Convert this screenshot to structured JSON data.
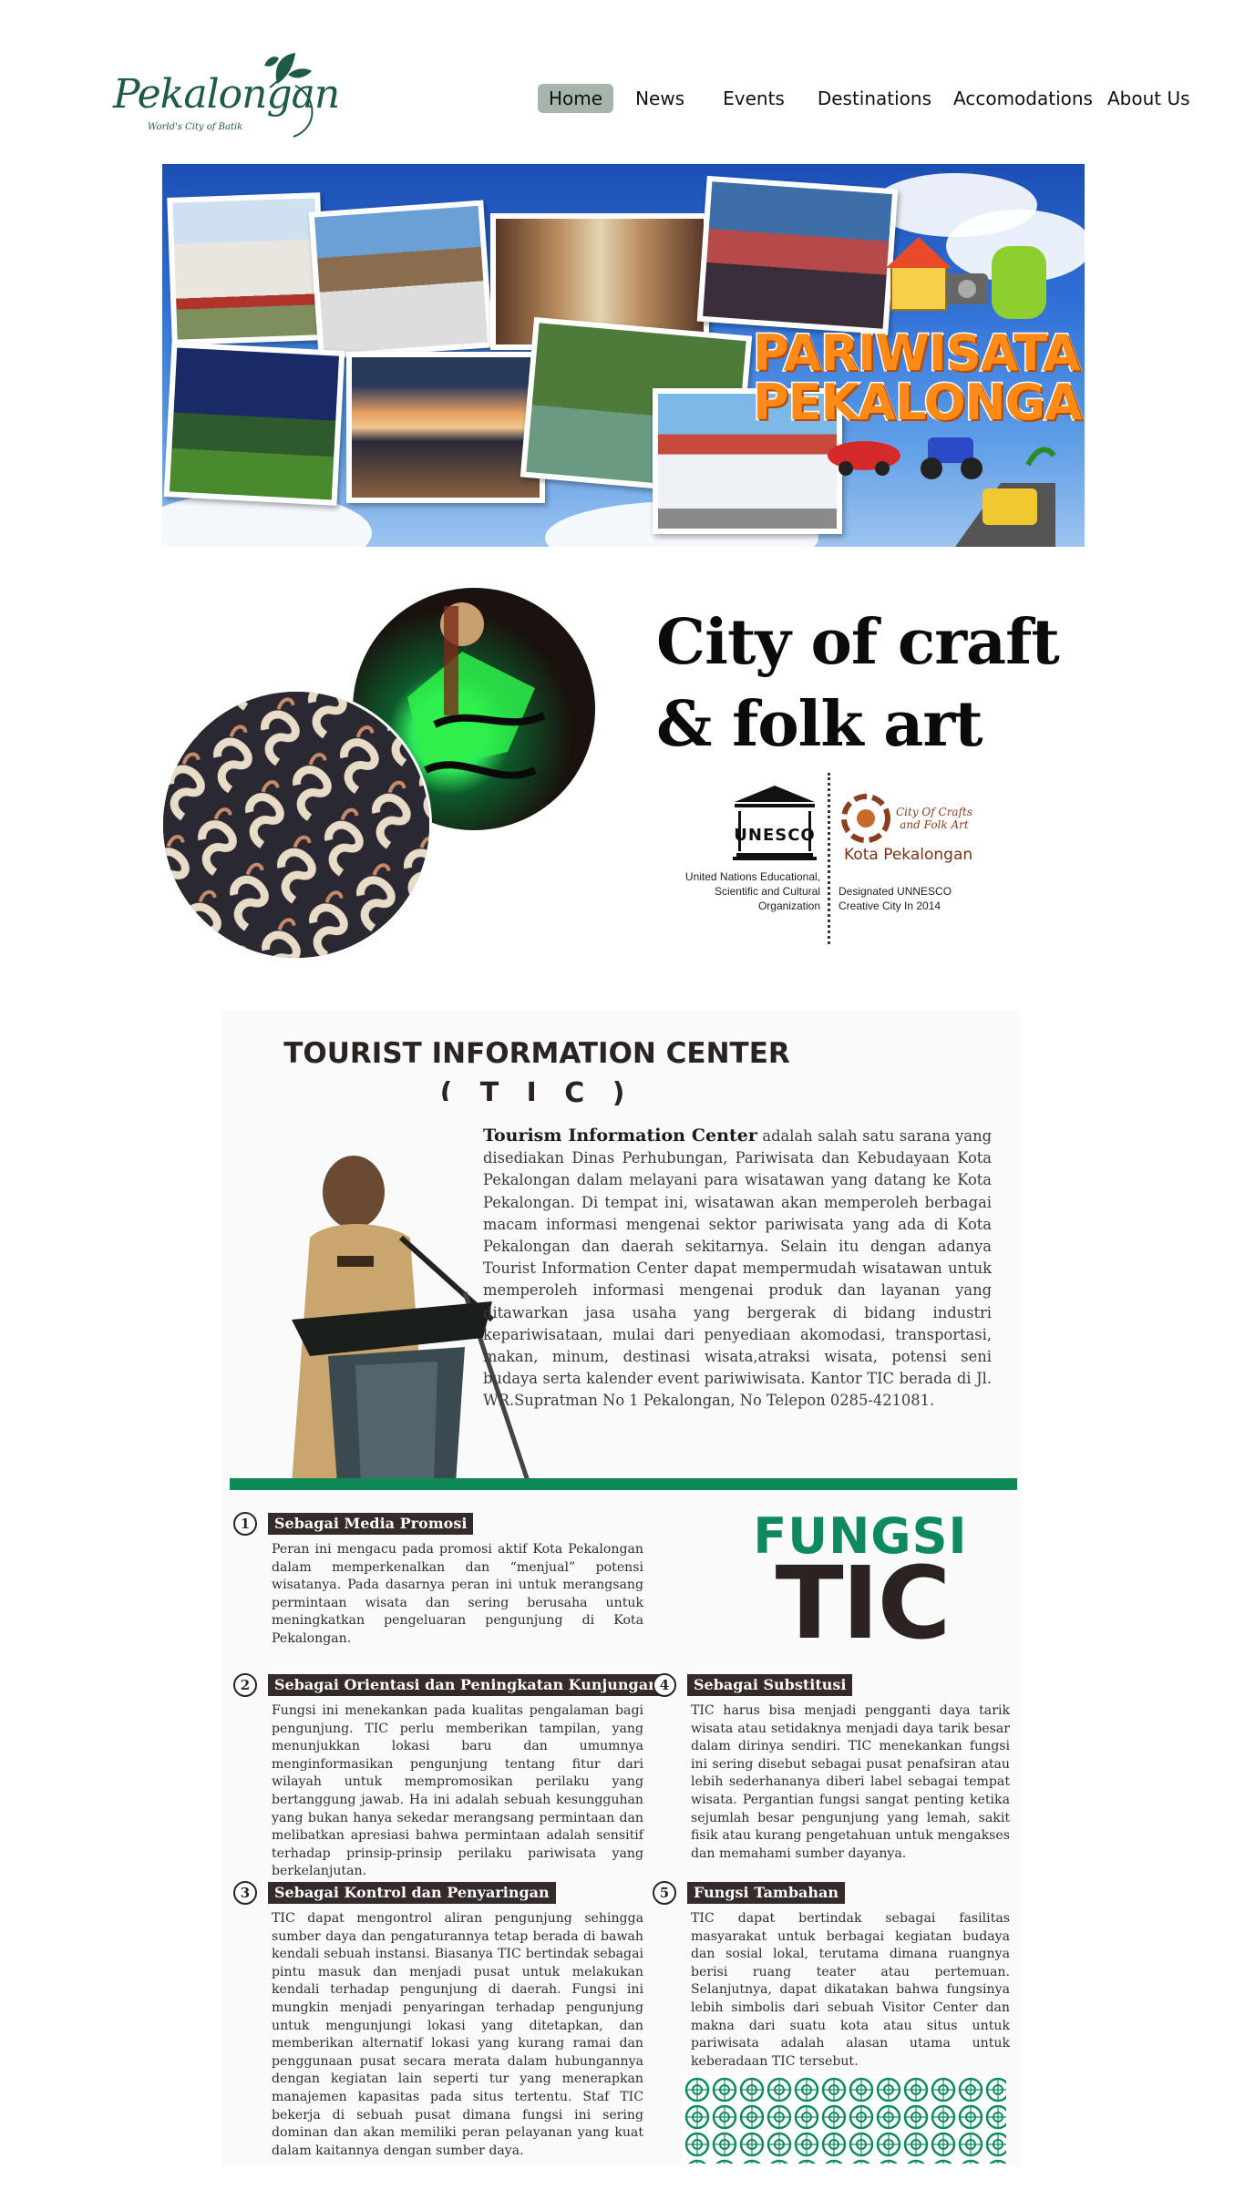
{
  "header": {
    "logo_text": "Pekalongan",
    "logo_tagline": "World's City of Batik",
    "nav": [
      "Home",
      "News",
      "Events",
      "Destinations",
      "Accomodations",
      "About Us"
    ],
    "active_nav": "Home"
  },
  "hero": {
    "title_line1": "PARIWISATA",
    "title_line2": "PEKALONGAN"
  },
  "craft": {
    "title": "City of craft & folk art",
    "unesco_name": "UNESCO",
    "unesco_label": "United Nations Educational, Scientific and Cultural Organization",
    "badge_text": "City Of Crafts and Folk Art",
    "kota": "Kota Pekalongan",
    "designated": "Designated UNNESCO Creative City In 2014"
  },
  "tic": {
    "heading": "TOURIST INFORMATION CENTER",
    "subheading": "( T I C )",
    "lead": "Tourism Information Center",
    "intro": " adalah salah satu sarana yang disediakan Dinas Perhubungan, Pariwisata dan Kebudayaan Kota Pekalongan dalam melayani para wisatawan yang datang ke Kota Pekalongan. Di tempat ini, wisatawan akan memperoleh berbagai macam informasi mengenai sektor pariwisata yang ada di Kota Pekalongan dan daerah sekitarnya. Selain itu dengan adanya Tourist Information Center dapat mempermudah wisatawan untuk memperoleh informasi mengenai produk dan layanan yang ditawarkan jasa usaha yang bergerak di bidang industri kepariwisataan, mulai dari penyediaan akomodasi, transportasi, makan, minum, destinasi wisata,atraksi wisata, potensi seni budaya serta kalender event pariwiwisata. Kantor TIC berada di Jl. WR.Supratman No 1 Pekalongan, No Telepon 0285-421081.",
    "fungsi_word": "FUNGSI",
    "fungsi_tic": "TIC",
    "functions": [
      {
        "num": "1",
        "title": "Sebagai Media Promosi",
        "body": "Peran ini mengacu pada promosi aktif Kota Pekalongan dalam memperkenalkan dan “menjual” potensi wisatanya. Pada dasarnya peran ini untuk merangsang permintaan wisata dan sering berusaha untuk meningkatkan pengeluaran pengunjung di Kota Pekalongan."
      },
      {
        "num": "2",
        "title": "Sebagai Orientasi dan Peningkatan Kunjungan",
        "body": "Fungsi ini menekankan pada kualitas pengalaman bagi pengunjung. TIC perlu memberikan tampilan, yang menunjukkan lokasi baru dan umumnya menginformasikan pengunjung tentang fitur dari wilayah untuk mempromosikan perilaku yang bertanggung jawab. Ha ini adalah sebuah kesungguhan yang bukan hanya sekedar merangsang permintaan dan melibatkan apresiasi bahwa permintaan adalah sensitif terhadap prinsip-prinsip perilaku pariwisata yang berkelanjutan."
      },
      {
        "num": "3",
        "title": "Sebagai Kontrol dan Penyaringan",
        "body": "TIC dapat mengontrol aliran pengunjung sehingga sumber daya dan pengaturannya tetap berada di bawah kendali sebuah instansi. Biasanya TIC bertindak sebagai pintu masuk dan menjadi pusat untuk melakukan kendali terhadap pengunjung di daerah. Fungsi ini mungkin menjadi penyaringan terhadap pengunjung untuk mengunjungi lokasi yang ditetapkan, dan memberikan alternatif lokasi yang kurang ramai dan penggunaan pusat secara merata dalam hubungannya dengan kegiatan lain seperti tur yang menerapkan manajemen kapasitas pada situs tertentu. Staf TIC bekerja di sebuah pusat dimana fungsi ini sering dominan dan akan memiliki peran pelayanan yang kuat dalam kaitannya dengan sumber daya."
      },
      {
        "num": "4",
        "title": "Sebagai Substitusi",
        "body": "TIC harus bisa menjadi pengganti daya tarik wisata atau setidaknya menjadi daya tarik besar dalam dirinya sendiri. TIC menekankan fungsi ini sering disebut sebagai pusat penafsiran atau lebih sederhananya diberi label sebagai tempat wisata. Pergantian fungsi sangat penting ketika sejumlah besar pengunjung yang lemah, sakit fisik atau kurang pengetahuan untuk mengakses dan memahami sumber dayanya."
      },
      {
        "num": "5",
        "title": "Fungsi Tambahan",
        "body": "TIC dapat bertindak sebagai fasilitas masyarakat untuk berbagai kegiatan budaya dan sosial lokal, terutama dimana ruangnya berisi ruang teater atau pertemuan. Selanjutnya, dapat dikatakan bahwa fungsinya lebih simbolis dari sebuah Visitor Center dan makna dari suatu kota atau situs untuk pariwisata adalah alasan utama untuk keberadaan TIC tersebut."
      }
    ]
  },
  "colors": {
    "brand_green": "#0e8a56",
    "dark": "#342b2a",
    "nav_active": "#a6b4ac",
    "hero_orange": "#ff8a17"
  }
}
